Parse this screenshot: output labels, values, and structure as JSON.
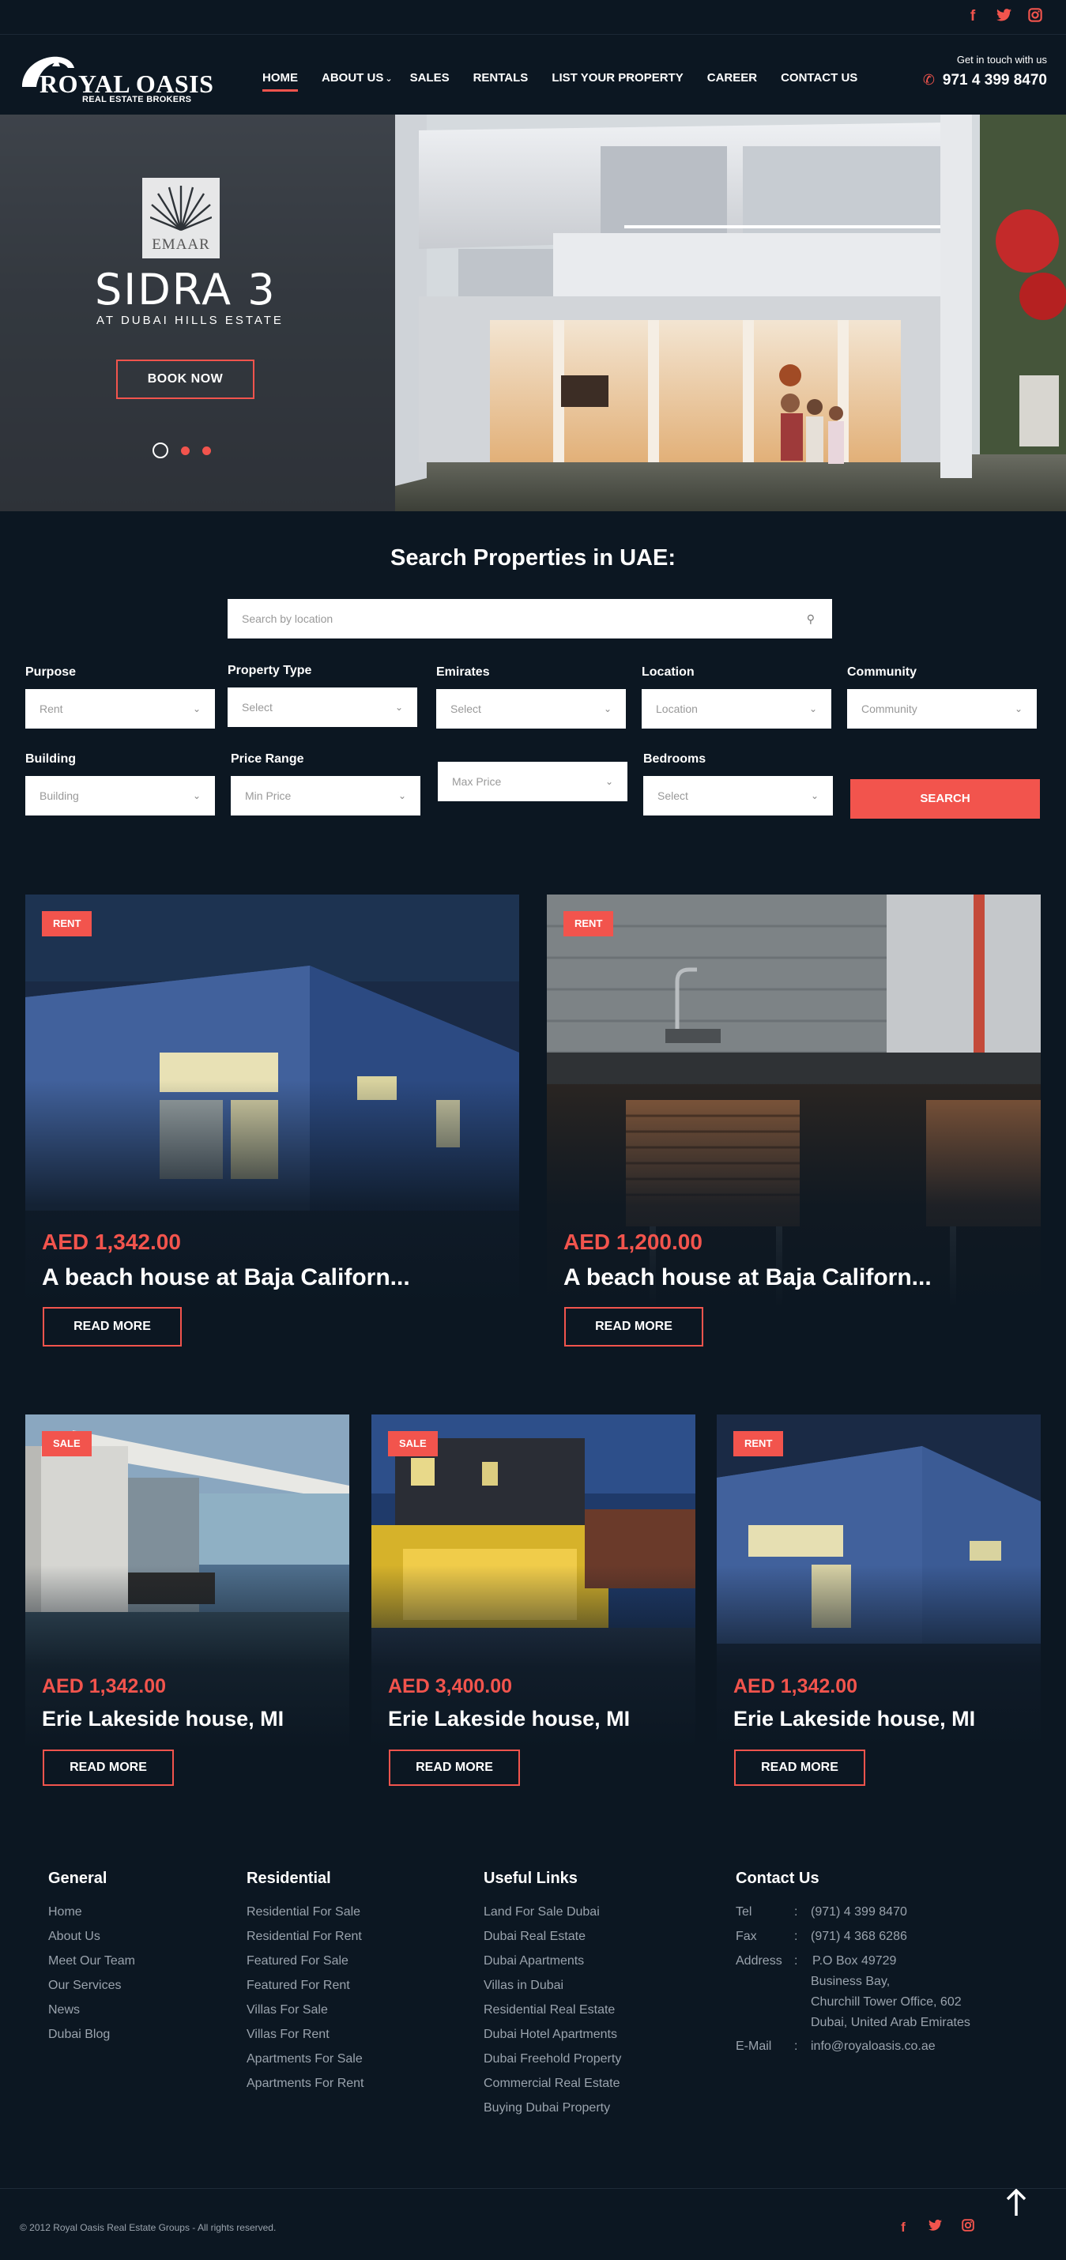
{
  "social": [
    "facebook-icon",
    "twitter-icon",
    "instagram-icon"
  ],
  "header": {
    "logo": {
      "brand": "ROYAL OASIS",
      "sub": "REAL ESTATE BROKERS"
    },
    "nav": [
      {
        "label": "HOME",
        "active": true
      },
      {
        "label": "ABOUT US",
        "dropdown": true
      },
      {
        "label": "SALES"
      },
      {
        "label": "RENTALS"
      },
      {
        "label": "LIST YOUR PROPERTY"
      },
      {
        "label": "CAREER"
      },
      {
        "label": "CONTACT US"
      }
    ],
    "contact_label": "Get in touch with us",
    "phone": "971 4 399 8470"
  },
  "hero": {
    "emaar": "EMAAR",
    "title": "SIDRA 3",
    "subtitle": "AT DUBAI HILLS ESTATE",
    "cta": "BOOK NOW",
    "slides": 3,
    "active_slide": 1
  },
  "search": {
    "title": "Search Properties in UAE:",
    "location_placeholder": "Search by location",
    "fields": [
      {
        "label": "Purpose",
        "value": "Rent"
      },
      {
        "label": "Property Type",
        "value": "Select"
      },
      {
        "label": "Emirates",
        "value": "Select"
      },
      {
        "label": "Location",
        "value": "Location"
      },
      {
        "label": "Community",
        "value": "Community"
      },
      {
        "label": "Building",
        "value": "Building"
      },
      {
        "label": "Price Range",
        "value": "Min Price"
      },
      {
        "label": "",
        "value": "Max Price"
      },
      {
        "label": "Bedrooms",
        "value": "Select"
      }
    ],
    "button": "SEARCH"
  },
  "listings": [
    {
      "badge": "RENT",
      "price": "AED 1,342.00",
      "title": "A beach house at Baja Californ...",
      "cta": "READ MORE"
    },
    {
      "badge": "RENT",
      "price": "AED 1,200.00",
      "title": "A beach house at Baja Californ...",
      "cta": "READ MORE"
    },
    {
      "badge": "SALE",
      "price": "AED 1,342.00",
      "title": "Erie Lakeside house, MI",
      "cta": "READ MORE"
    },
    {
      "badge": "SALE",
      "price": "AED 3,400.00",
      "title": "Erie Lakeside house, MI",
      "cta": "READ MORE"
    },
    {
      "badge": "RENT",
      "price": "AED 1,342.00",
      "title": "Erie Lakeside house, MI",
      "cta": "READ MORE"
    }
  ],
  "footer": {
    "general": {
      "title": "General",
      "links": [
        "Home",
        "About Us",
        "Meet Our Team",
        "Our Services",
        "News",
        "Dubai Blog"
      ]
    },
    "residential": {
      "title": "Residential",
      "links": [
        "Residential For Sale",
        "Residential For Rent",
        "Featured For Sale",
        "Featured For Rent",
        "Villas For Sale",
        "Villas For Rent",
        "Apartments For Sale",
        "Apartments For Rent"
      ]
    },
    "useful": {
      "title": "Useful Links",
      "links": [
        "Land For Sale Dubai",
        "Dubai Real Estate",
        "Dubai Apartments",
        "Villas in Dubai",
        "Residential Real Estate",
        "Dubai Hotel Apartments",
        "Dubai Freehold Property",
        "Commercial Real Estate",
        "Buying Dubai Property"
      ]
    },
    "contact": {
      "title": "Contact Us",
      "tel_label": "Tel",
      "tel": "(971) 4 399 8470",
      "fax_label": "Fax",
      "fax": "(971) 4 368 6286",
      "address_label": "Address",
      "address": [
        "P.O Box 49729",
        "Business Bay,",
        "Churchill Tower Office, 602",
        "Dubai, United Arab Emirates"
      ],
      "email_label": "E-Mail",
      "email": "info@royaloasis.co.ae"
    },
    "copyright": "© 2012 Royal Oasis Real Estate Groups - All rights reserved."
  },
  "colors": {
    "accent": "#f2544d",
    "background": "#0c1722"
  }
}
